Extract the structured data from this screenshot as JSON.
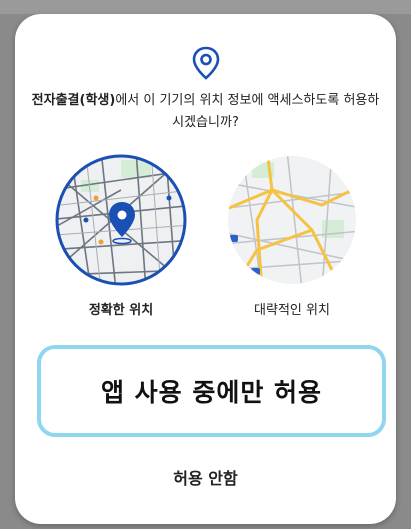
{
  "dialog": {
    "icon": "location-pin-icon",
    "app_name": "전자출결(학생)",
    "message_rest": "에서 이 기기의 위치 정보에 액세스하도록 허용하시겠습니까?",
    "accent_color": "#1a4fb3",
    "options": [
      {
        "id": "precise",
        "label": "정확한 위치",
        "selected": true,
        "icon": "precise-location-map-icon"
      },
      {
        "id": "approximate",
        "label": "대략적인 위치",
        "selected": false,
        "icon": "approximate-location-map-icon"
      }
    ],
    "allow_button": "앱 사용 중에만 허용",
    "deny_button": "허용 안함"
  }
}
